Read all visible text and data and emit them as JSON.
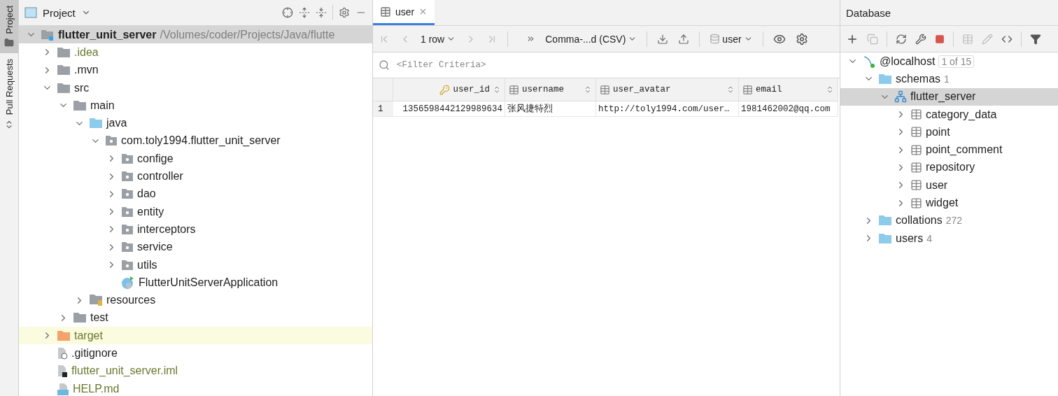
{
  "side_stripe": [
    {
      "label": "Project",
      "selected": true
    },
    {
      "label": "Pull Requests",
      "selected": false
    }
  ],
  "project": {
    "title": "Project",
    "tree": [
      {
        "name": "flutter_unit_server",
        "kind": "module",
        "path": "/Volumes/coder/Projects/Java/flutte",
        "expanded": true,
        "selected": true,
        "ignored": false,
        "children": [
          {
            "name": ".idea",
            "kind": "folder",
            "expanded": false,
            "selected": false,
            "ignored": true
          },
          {
            "name": ".mvn",
            "kind": "folder",
            "expanded": false,
            "selected": false,
            "ignored": false
          },
          {
            "name": "src",
            "kind": "folder",
            "expanded": true,
            "selected": false,
            "ignored": false,
            "children": [
              {
                "name": "main",
                "kind": "folder",
                "expanded": true,
                "selected": false,
                "ignored": false,
                "children": [
                  {
                    "name": "java",
                    "kind": "source",
                    "expanded": true,
                    "selected": false,
                    "ignored": false,
                    "children": [
                      {
                        "name": "com.toly1994.flutter_unit_server",
                        "kind": "package",
                        "expanded": true,
                        "selected": false,
                        "ignored": false,
                        "children": [
                          {
                            "name": "confige",
                            "kind": "package",
                            "expanded": false,
                            "selected": false,
                            "ignored": false
                          },
                          {
                            "name": "controller",
                            "kind": "package",
                            "expanded": false,
                            "selected": false,
                            "ignored": false
                          },
                          {
                            "name": "dao",
                            "kind": "package",
                            "expanded": false,
                            "selected": false,
                            "ignored": false
                          },
                          {
                            "name": "entity",
                            "kind": "package",
                            "expanded": false,
                            "selected": false,
                            "ignored": false
                          },
                          {
                            "name": "interceptors",
                            "kind": "package",
                            "expanded": false,
                            "selected": false,
                            "ignored": false
                          },
                          {
                            "name": "service",
                            "kind": "package",
                            "expanded": false,
                            "selected": false,
                            "ignored": false
                          },
                          {
                            "name": "utils",
                            "kind": "package",
                            "expanded": false,
                            "selected": false,
                            "ignored": false
                          },
                          {
                            "name": "FlutterUnitServerApplication",
                            "kind": "class",
                            "selected": false,
                            "ignored": false
                          }
                        ]
                      }
                    ]
                  },
                  {
                    "name": "resources",
                    "kind": "resources",
                    "expanded": false,
                    "selected": false,
                    "ignored": false
                  }
                ]
              },
              {
                "name": "test",
                "kind": "folder",
                "expanded": false,
                "selected": false,
                "ignored": false
              }
            ]
          },
          {
            "name": "target",
            "kind": "excluded",
            "expanded": false,
            "selected": false,
            "ignored": true
          },
          {
            "name": ".gitignore",
            "kind": "gitignore",
            "selected": false,
            "ignored": false
          },
          {
            "name": "flutter_unit_server.iml",
            "kind": "iml",
            "selected": false,
            "ignored": true
          },
          {
            "name": "HELP.md",
            "kind": "markdown",
            "selected": false,
            "ignored": true
          }
        ]
      }
    ]
  },
  "editor": {
    "tabs": [
      {
        "label": "user",
        "selected": true
      }
    ],
    "toolbar": {
      "rows": "1 row",
      "format": "Comma-...d (CSV)",
      "datasource": "user"
    },
    "filter": {
      "placeholder": "<Filter Criteria>"
    },
    "table": {
      "columns": [
        {
          "label": "user_id",
          "kind": "key"
        },
        {
          "label": "username",
          "kind": "plain"
        },
        {
          "label": "user_avatar",
          "kind": "plain"
        },
        {
          "label": "email",
          "kind": "plain"
        }
      ],
      "rows": [
        {
          "number": "1",
          "cells": [
            "1356598442129989634",
            "张风捷特烈",
            "http://toly1994.com/user…",
            "1981462002@qq.com"
          ]
        }
      ]
    }
  },
  "database": {
    "title": "Database",
    "tree": [
      {
        "name": "@localhost",
        "kind": "host",
        "badge": "1 of 15",
        "expanded": true,
        "selected": false,
        "children": [
          {
            "name": "schemas",
            "kind": "folder",
            "count": "1",
            "expanded": true,
            "selected": false,
            "children": [
              {
                "name": "flutter_server",
                "kind": "schema",
                "expanded": true,
                "selected": true,
                "children": [
                  {
                    "name": "category_data",
                    "kind": "table",
                    "expanded": false,
                    "selected": false
                  },
                  {
                    "name": "point",
                    "kind": "table",
                    "expanded": false,
                    "selected": false
                  },
                  {
                    "name": "point_comment",
                    "kind": "table",
                    "expanded": false,
                    "selected": false
                  },
                  {
                    "name": "repository",
                    "kind": "table",
                    "expanded": false,
                    "selected": false
                  },
                  {
                    "name": "user",
                    "kind": "table",
                    "expanded": false,
                    "selected": false
                  },
                  {
                    "name": "widget",
                    "kind": "table",
                    "expanded": false,
                    "selected": false
                  }
                ]
              }
            ]
          },
          {
            "name": "collations",
            "kind": "folder",
            "count": "272",
            "expanded": false,
            "selected": false
          },
          {
            "name": "users",
            "kind": "folder",
            "count": "4",
            "expanded": false,
            "selected": false
          }
        ]
      }
    ]
  }
}
